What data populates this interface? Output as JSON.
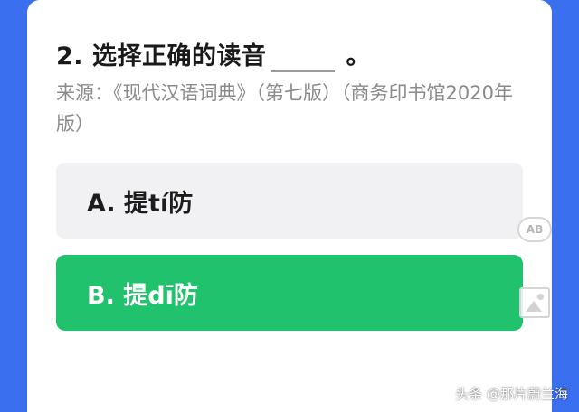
{
  "question": {
    "title": "2. 选择正确的读音",
    "end_mark": "。",
    "source": "来源：《现代汉语词典》（第七版）（商务印书馆2020年版）"
  },
  "options": [
    {
      "label": "A. 提tí防",
      "state": "default"
    },
    {
      "label": "B. 提dī防",
      "state": "selected"
    }
  ],
  "side_icons": {
    "ab_label": "AB",
    "image_icon": "image-icon"
  },
  "watermark": "头条 @那片蔚兰海",
  "colors": {
    "background": "#3a6ff0",
    "selected_option": "#21c26e",
    "default_option": "#f1f1f3"
  }
}
